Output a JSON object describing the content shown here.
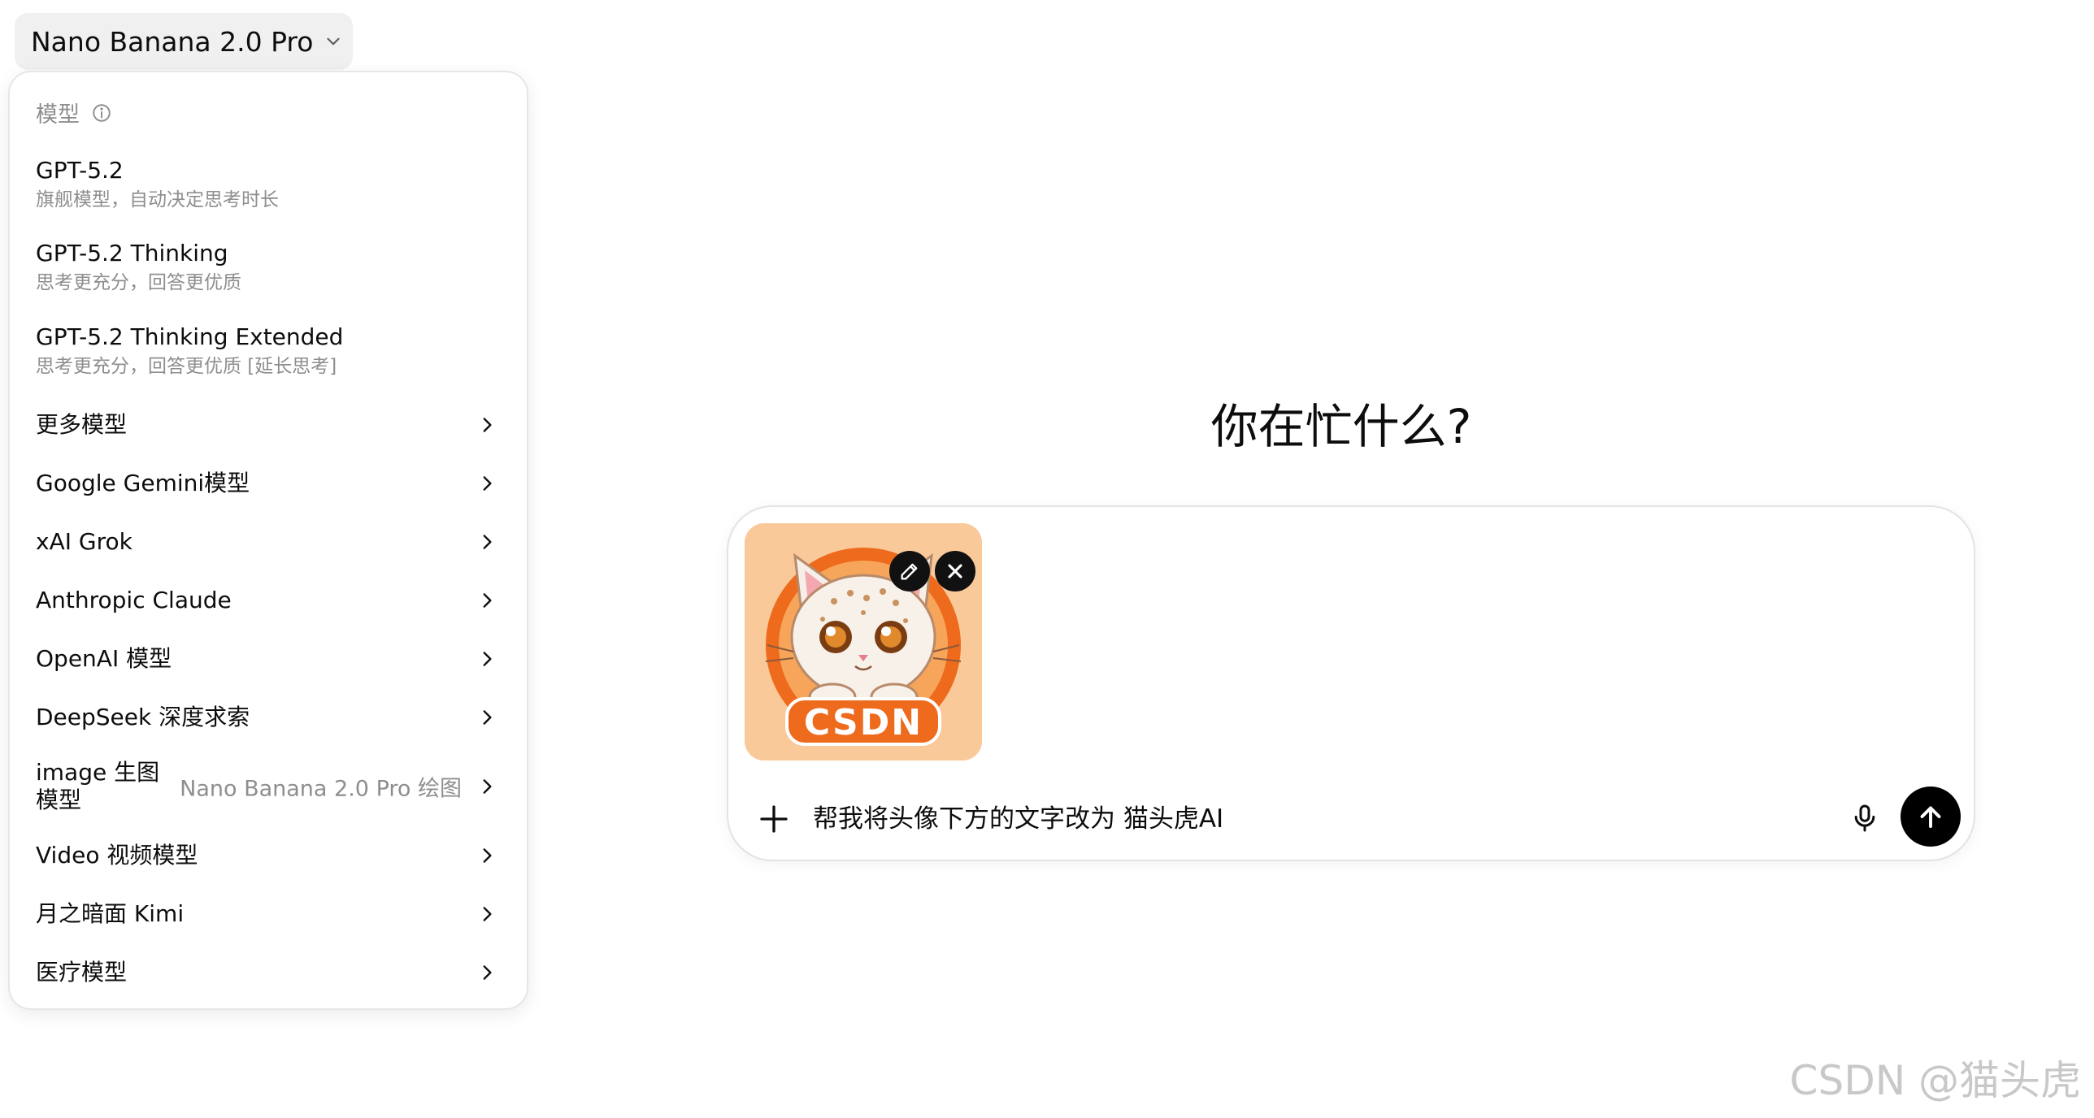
{
  "model_selector": {
    "label": "Nano Banana 2.0 Pro",
    "icon": "chevron-down-icon"
  },
  "menu": {
    "header": "模型",
    "header_icon": "info-icon",
    "items": [
      {
        "title": "GPT-5.2",
        "desc": "旗舰模型，自动决定思考时长"
      },
      {
        "title": "GPT-5.2 Thinking",
        "desc": "思考更充分，回答更优质"
      },
      {
        "title": "GPT-5.2 Thinking Extended",
        "desc": "思考更充分，回答更优质 [延长思考]"
      }
    ],
    "submenus": [
      {
        "title": "更多模型"
      },
      {
        "title": "Google Gemini模型"
      },
      {
        "title": "xAI Grok"
      },
      {
        "title": "Anthropic Claude"
      },
      {
        "title": "OpenAI 模型"
      },
      {
        "title": "DeepSeek 深度求索"
      },
      {
        "title_line1": "image 生图",
        "title_line2": "模型",
        "meta": "Nano Banana 2.0 Pro 绘图"
      },
      {
        "title": "Video 视频模型"
      },
      {
        "title": "月之暗面 Kimi"
      },
      {
        "title": "医疗模型"
      }
    ]
  },
  "main": {
    "heading": "你在忙什么?",
    "composer": {
      "input_value": "帮我将头像下方的文字改为 猫头虎AI",
      "attachment_text": "CSDN",
      "edit_icon": "pencil-icon",
      "remove_icon": "close-icon",
      "add_icon": "plus-icon",
      "mic_icon": "microphone-icon",
      "send_icon": "arrow-up-icon"
    }
  },
  "watermark": "CSDN @猫头虎",
  "colors": {
    "accent": "#000000",
    "muted": "#8e8e8e",
    "thumb_bg": "#f9c99a",
    "thumb_orange": "#ee6a1c"
  }
}
